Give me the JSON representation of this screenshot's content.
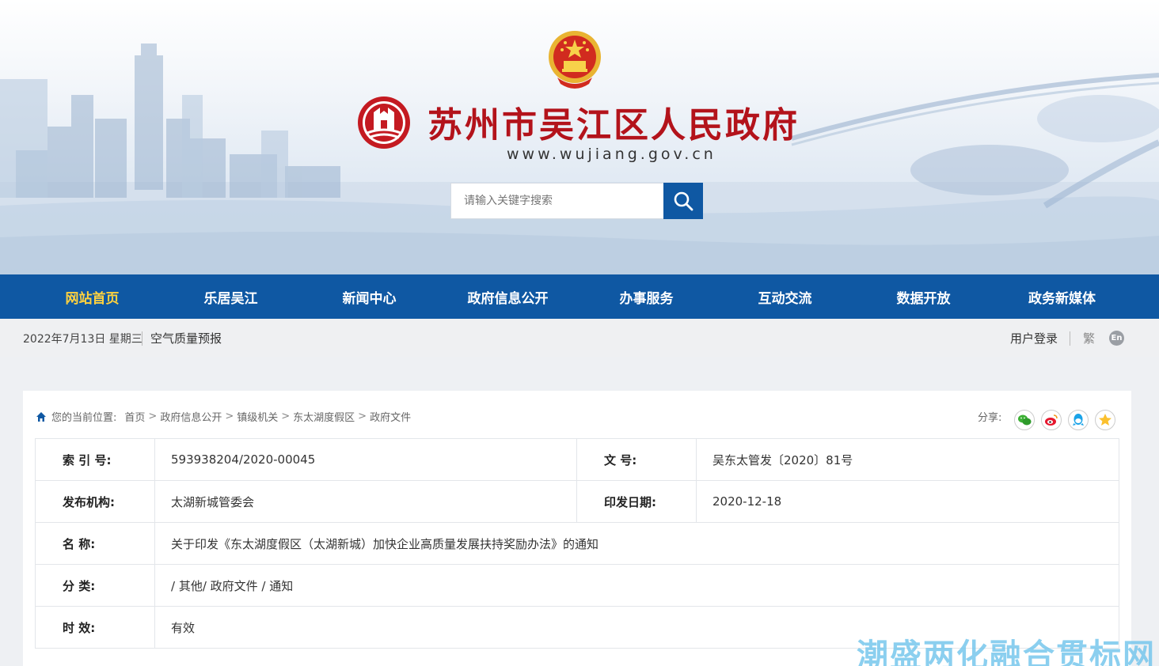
{
  "header": {
    "site_title": "苏州市吴江区人民政府",
    "site_url": "www.wujiang.gov.cn",
    "search_placeholder": "请输入关键字搜索"
  },
  "nav": {
    "items": [
      {
        "label": "网站首页",
        "active": true
      },
      {
        "label": "乐居吴江",
        "active": false
      },
      {
        "label": "新闻中心",
        "active": false
      },
      {
        "label": "政府信息公开",
        "active": false
      },
      {
        "label": "办事服务",
        "active": false
      },
      {
        "label": "互动交流",
        "active": false
      },
      {
        "label": "数据开放",
        "active": false
      },
      {
        "label": "政务新媒体",
        "active": false
      }
    ]
  },
  "infobar": {
    "date": "2022年7月13日 星期三",
    "air_quality": "空气质量预报",
    "login": "用户登录",
    "traditional": "繁",
    "english": "En"
  },
  "breadcrumb": {
    "lead": "您的当前位置:",
    "items": [
      "首页",
      "政府信息公开",
      "镇级机关",
      "东太湖度假区",
      "政府文件"
    ],
    "separator": ">"
  },
  "share": {
    "label": "分享:",
    "icons": [
      "wechat-icon",
      "weibo-icon",
      "qq-icon",
      "qzone-icon"
    ]
  },
  "document": {
    "index_label": "索 引 号:",
    "index_value": "593938204/2020-00045",
    "docno_label": "文    号:",
    "docno_value": "吴东太管发〔2020〕81号",
    "publisher_label": "发布机构:",
    "publisher_value": "太湖新城管委会",
    "date_label": "印发日期:",
    "date_value": "2020-12-18",
    "name_label": "名    称:",
    "name_value": "关于印发《东太湖度假区（太湖新城）加快企业高质量发展扶持奖励办法》的通知",
    "category_label": "分    类:",
    "category_value": "/ 其他/ 政府文件 / 通知",
    "validity_label": "时    效:",
    "validity_value": "有效"
  },
  "watermark": "潮盛两化融合贯标网",
  "colors": {
    "nav_bg": "#0f58a3",
    "nav_active": "#ffd23f",
    "title_red": "#b3131b"
  }
}
